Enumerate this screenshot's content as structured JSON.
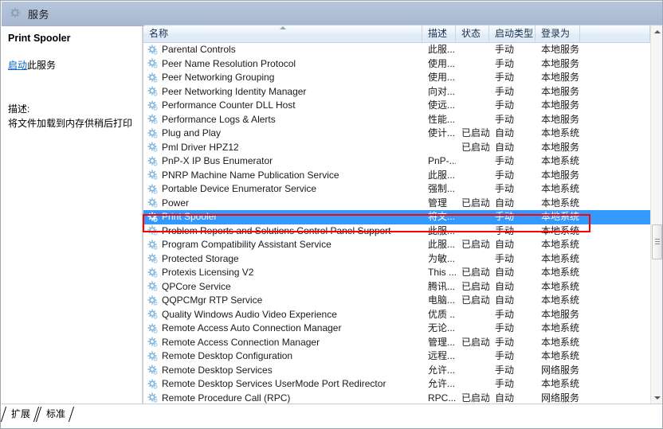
{
  "window": {
    "title": "服务",
    "title_icon": "gear-icon"
  },
  "detail_pane": {
    "service_title": "Print Spooler",
    "action_link": "启动",
    "action_suffix": "此服务",
    "description_label": "描述:",
    "description_text": "将文件加载到内存供稍后打印"
  },
  "list": {
    "columns": [
      {
        "key": "name",
        "label": "名称",
        "sorted": true
      },
      {
        "key": "desc",
        "label": "描述",
        "sorted": false
      },
      {
        "key": "state",
        "label": "状态",
        "sorted": false
      },
      {
        "key": "start",
        "label": "启动类型",
        "sorted": false
      },
      {
        "key": "logon",
        "label": "登录为",
        "sorted": false
      }
    ],
    "rows": [
      {
        "name": "Parental Controls",
        "desc": "此服...",
        "state": "",
        "start": "手动",
        "logon": "本地服务",
        "selected": false
      },
      {
        "name": "Peer Name Resolution Protocol",
        "desc": "使用...",
        "state": "",
        "start": "手动",
        "logon": "本地服务",
        "selected": false
      },
      {
        "name": "Peer Networking Grouping",
        "desc": "使用...",
        "state": "",
        "start": "手动",
        "logon": "本地服务",
        "selected": false
      },
      {
        "name": "Peer Networking Identity Manager",
        "desc": "向对...",
        "state": "",
        "start": "手动",
        "logon": "本地服务",
        "selected": false
      },
      {
        "name": "Performance Counter DLL Host",
        "desc": "使远...",
        "state": "",
        "start": "手动",
        "logon": "本地服务",
        "selected": false
      },
      {
        "name": "Performance Logs & Alerts",
        "desc": "性能...",
        "state": "",
        "start": "手动",
        "logon": "本地服务",
        "selected": false
      },
      {
        "name": "Plug and Play",
        "desc": "使计...",
        "state": "已启动",
        "start": "自动",
        "logon": "本地系统",
        "selected": false
      },
      {
        "name": "Pml Driver HPZ12",
        "desc": "",
        "state": "已启动",
        "start": "自动",
        "logon": "本地服务",
        "selected": false
      },
      {
        "name": "PnP-X IP Bus Enumerator",
        "desc": "PnP-...",
        "state": "",
        "start": "手动",
        "logon": "本地系统",
        "selected": false
      },
      {
        "name": "PNRP Machine Name Publication Service",
        "desc": "此服...",
        "state": "",
        "start": "手动",
        "logon": "本地服务",
        "selected": false
      },
      {
        "name": "Portable Device Enumerator Service",
        "desc": "强制...",
        "state": "",
        "start": "手动",
        "logon": "本地系统",
        "selected": false
      },
      {
        "name": "Power",
        "desc": "管理",
        "state": "已启动",
        "start": "自动",
        "logon": "本地系统",
        "selected": false
      },
      {
        "name": "Print Spooler",
        "desc": "将文...",
        "state": "",
        "start": "手动",
        "logon": "本地系统",
        "selected": true
      },
      {
        "name": "Problem Reports and Solutions Control Panel Support",
        "desc": "此服...",
        "state": "",
        "start": "手动",
        "logon": "本地系统",
        "selected": false
      },
      {
        "name": "Program Compatibility Assistant Service",
        "desc": "此服...",
        "state": "已启动",
        "start": "自动",
        "logon": "本地系统",
        "selected": false
      },
      {
        "name": "Protected Storage",
        "desc": "为敏...",
        "state": "",
        "start": "手动",
        "logon": "本地系统",
        "selected": false
      },
      {
        "name": "Protexis Licensing V2",
        "desc": "This ...",
        "state": "已启动",
        "start": "自动",
        "logon": "本地系统",
        "selected": false
      },
      {
        "name": "QPCore Service",
        "desc": "腾讯...",
        "state": "已启动",
        "start": "自动",
        "logon": "本地系统",
        "selected": false
      },
      {
        "name": "QQPCMgr RTP Service",
        "desc": "电脑...",
        "state": "已启动",
        "start": "自动",
        "logon": "本地系统",
        "selected": false
      },
      {
        "name": "Quality Windows Audio Video Experience",
        "desc": "优质 ...",
        "state": "",
        "start": "手动",
        "logon": "本地服务",
        "selected": false
      },
      {
        "name": "Remote Access Auto Connection Manager",
        "desc": "无论...",
        "state": "",
        "start": "手动",
        "logon": "本地系统",
        "selected": false
      },
      {
        "name": "Remote Access Connection Manager",
        "desc": "管理...",
        "state": "已启动",
        "start": "手动",
        "logon": "本地系统",
        "selected": false
      },
      {
        "name": "Remote Desktop Configuration",
        "desc": "远程...",
        "state": "",
        "start": "手动",
        "logon": "本地系统",
        "selected": false
      },
      {
        "name": "Remote Desktop Services",
        "desc": "允许...",
        "state": "",
        "start": "手动",
        "logon": "网络服务",
        "selected": false
      },
      {
        "name": "Remote Desktop Services UserMode Port Redirector",
        "desc": "允许...",
        "state": "",
        "start": "手动",
        "logon": "本地系统",
        "selected": false
      },
      {
        "name": "Remote Procedure Call (RPC)",
        "desc": "RPC...",
        "state": "已启动",
        "start": "自动",
        "logon": "网络服务",
        "selected": false
      }
    ]
  },
  "footer_tabs": [
    {
      "label": "扩展",
      "active": false
    },
    {
      "label": "标准",
      "active": true
    }
  ],
  "annotation": {
    "color": "#ff0000",
    "target_row": "Print Spooler"
  },
  "colors": {
    "selection": "#3399ff",
    "link": "#0066cc",
    "titlebar": "#aebfd6",
    "header": "#e2ecf7"
  }
}
